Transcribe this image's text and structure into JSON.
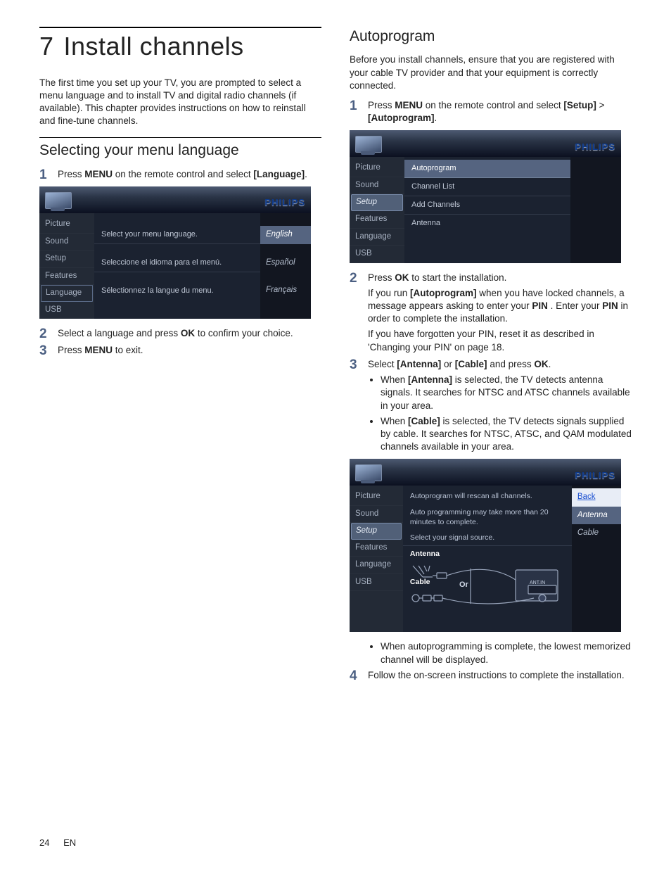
{
  "chapter": {
    "num": "7",
    "title": "Install channels"
  },
  "intro": "The first time you set up your TV, you are prompted to select a menu language and to install TV and digital radio channels (if available). This chapter provides instructions on how to reinstall and fine-tune channels.",
  "section_lang": {
    "title": "Selecting your menu language",
    "step1_a": "Press ",
    "step1_b": "MENU",
    "step1_c": " on the remote control and select ",
    "step1_d": "[Language]",
    "step1_e": ".",
    "step2_a": "Select a language and press ",
    "step2_b": "OK",
    "step2_c": " to confirm your choice.",
    "step3_a": "Press ",
    "step3_b": "MENU",
    "step3_c": " to exit."
  },
  "fig_lang": {
    "logo": "PHILIPS",
    "left": [
      "Picture",
      "Sound",
      "Setup",
      "Features",
      "Language",
      "USB"
    ],
    "left_boxed": "Language",
    "mid": [
      {
        "t": "Select your menu language.",
        "hl": false,
        "spacer_before": true
      },
      {
        "t": "Seleccione el idioma para el menú.",
        "hl": false,
        "spacer_before": true
      },
      {
        "t": "Sélectionnez la langue du menu.",
        "hl": false,
        "spacer_before": true
      }
    ],
    "right": [
      {
        "t": "English",
        "hl": true
      },
      {
        "t": "Español",
        "hl": false
      },
      {
        "t": "Français",
        "hl": false
      }
    ]
  },
  "section_auto": {
    "title": "Autoprogram",
    "intro": "Before you install channels, ensure that you are registered with your cable TV provider and that your equipment is correctly connected.",
    "step1_a": "Press ",
    "step1_b": "MENU",
    "step1_c": " on the remote control and select ",
    "step1_d": "[Setup]",
    "step1_e": " > ",
    "step1_f": "[Autoprogram]",
    "step1_g": ".",
    "step2_a": "Press ",
    "step2_b": "OK",
    "step2_c": " to start the installation.",
    "step2_sub_a": "If you run ",
    "step2_sub_b": "[Autoprogram]",
    "step2_sub_c": " when you have locked channels, a message appears asking to enter your ",
    "step2_sub_d": "PIN",
    "step2_sub_e": " . Enter your ",
    "step2_sub_f": "PIN",
    "step2_sub_g": " in order to complete the installation.",
    "step2_note": "If you have forgotten your PIN, reset it as described in 'Changing your PIN' on page 18.",
    "step3_a": "Select ",
    "step3_b": "[Antenna]",
    "step3_c": " or ",
    "step3_d": "[Cable]",
    "step3_e": " and press ",
    "step3_f": "OK",
    "step3_g": ".",
    "bullet_a1": "When ",
    "bullet_a2": "[Antenna]",
    "bullet_a3": " is selected, the TV detects antenna signals. It searches for NTSC and ATSC channels available in your area.",
    "bullet_b1": "When ",
    "bullet_b2": "[Cable]",
    "bullet_b3": " is selected, the TV detects signals supplied by cable. It searches for NTSC, ATSC, and QAM modulated channels available in your area.",
    "bullet_c": "When autoprogramming is complete, the lowest memorized channel will be displayed.",
    "step4": "Follow the on-screen instructions to complete the installation."
  },
  "fig_auto1": {
    "logo": "PHILIPS",
    "left": [
      "Picture",
      "Sound",
      "Setup",
      "Features",
      "Language",
      "USB"
    ],
    "left_selected": "Setup",
    "mid": [
      {
        "t": "Autoprogram",
        "hl": true
      },
      {
        "t": "Channel List",
        "hl": false
      },
      {
        "t": "Add Channels",
        "hl": false
      },
      {
        "t": "Antenna",
        "hl": false
      }
    ]
  },
  "fig_auto2": {
    "logo": "PHILIPS",
    "left": [
      "Picture",
      "Sound",
      "Setup",
      "Features",
      "Language",
      "USB"
    ],
    "left_selected": "Setup",
    "info": [
      "Autoprogram will rescan all channels.",
      "Auto programming  may take more than 20 minutes to complete.",
      "Select your signal source."
    ],
    "graphic_labels": {
      "antenna": "Antenna",
      "cable": "Cable",
      "or": "Or",
      "antin": "ANT.IN"
    },
    "right": [
      {
        "t": "Back",
        "cls": "back"
      },
      {
        "t": "Antenna",
        "cls": "hl"
      },
      {
        "t": "Cable",
        "cls": ""
      }
    ]
  },
  "footer": {
    "page": "24",
    "lang": "EN"
  }
}
